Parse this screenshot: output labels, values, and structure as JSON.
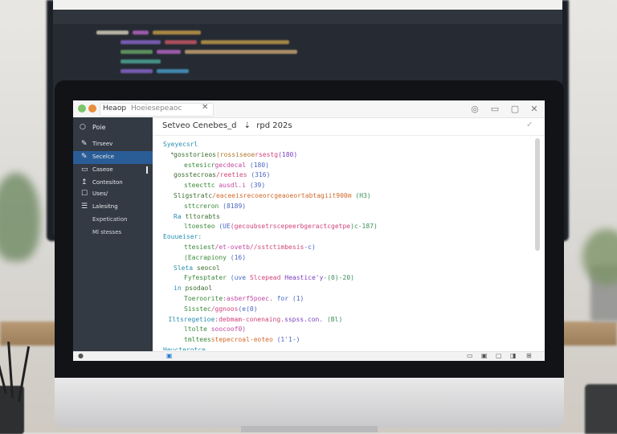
{
  "titlebar": {
    "app_name": "Heaop",
    "subtitle": "Hoeiesepeaoc",
    "close_glyph": "✕",
    "window_controls": [
      "◎",
      "▭",
      "▢",
      "✕"
    ]
  },
  "sidebar": {
    "header": "Poie",
    "items": [
      {
        "icon": "✎",
        "label": "Tirseev",
        "active": false,
        "sub": false
      },
      {
        "icon": "✎",
        "label": "Secelce",
        "active": true,
        "sub": false
      },
      {
        "icon": "▭",
        "label": "Caseoe",
        "active": false,
        "sub": false
      },
      {
        "icon": "↥",
        "label": "Contesiton",
        "active": false,
        "sub": false
      },
      {
        "icon": "☐",
        "label": "Uses/",
        "active": false,
        "sub": false
      },
      {
        "icon": "☰",
        "label": "Lalesitng",
        "active": false,
        "sub": false
      },
      {
        "icon": "",
        "label": "Expetication",
        "active": false,
        "sub": true
      },
      {
        "icon": "",
        "label": "Ml stesses",
        "active": false,
        "sub": true
      }
    ]
  },
  "editor": {
    "title": "Setveo Cenebes_d",
    "title_icon": "⇣",
    "title_suffix": "rpd 202s",
    "check": "✓",
    "lines": [
      {
        "indent": 0,
        "gutter": "",
        "segments": [
          {
            "t": "Syeyecsrl",
            "c": "#2a8fb0"
          }
        ]
      },
      {
        "indent": 2,
        "gutter": "•",
        "segments": [
          {
            "t": "gosstorieos",
            "c": "#3b6e2f"
          },
          {
            "t": "(rossiseoe",
            "c": "#b0742a"
          },
          {
            "t": "rsestg",
            "c": "#d0457b"
          },
          {
            "t": "(180)",
            "c": "#7a3fbf"
          }
        ]
      },
      {
        "indent": 4,
        "gutter": "",
        "segments": [
          {
            "t": "estesicr",
            "c": "#3b8a3b"
          },
          {
            "t": "gecdecal",
            "c": "#c24aa2"
          },
          {
            "t": " (180)",
            "c": "#4a67c4"
          }
        ]
      },
      {
        "indent": 2,
        "gutter": "",
        "segments": [
          {
            "t": "gosstecroas",
            "c": "#3b6e2f"
          },
          {
            "t": "/reeties",
            "c": "#d0457b"
          },
          {
            "t": " (316)",
            "c": "#4a67c4"
          }
        ]
      },
      {
        "indent": 4,
        "gutter": "",
        "segments": [
          {
            "t": "steecttc",
            "c": "#3b8a3b"
          },
          {
            "t": " ausdl.i",
            "c": "#c24aa2"
          },
          {
            "t": " (39)",
            "c": "#4a67c4"
          }
        ]
      },
      {
        "indent": 2,
        "gutter": "",
        "segments": [
          {
            "t": "Sligstratc",
            "c": "#3b6e2f"
          },
          {
            "t": "/eaceeisrecoeorcgeaoeortabtagiit900m",
            "c": "#d06a2a"
          },
          {
            "t": " (H3)",
            "c": "#3a8f5a"
          }
        ]
      },
      {
        "indent": 4,
        "gutter": "",
        "segments": [
          {
            "t": "sttcreron",
            "c": "#3b8a3b"
          },
          {
            "t": " (8189)",
            "c": "#4a67c4"
          }
        ]
      },
      {
        "indent": 2,
        "gutter": "",
        "segments": [
          {
            "t": "Ra",
            "c": "#2a8fb0"
          },
          {
            "t": " tltorabts",
            "c": "#3b6e2f"
          }
        ]
      },
      {
        "indent": 4,
        "gutter": "",
        "segments": [
          {
            "t": "ltoesteo",
            "c": "#3b8a3b"
          },
          {
            "t": " (UE",
            "c": "#4a67c4"
          },
          {
            "t": "(gecoubsetrscepeerbgeractcgetpe",
            "c": "#d0457b"
          },
          {
            "t": ")c-187)",
            "c": "#3a8f5a"
          }
        ]
      },
      {
        "indent": 0,
        "gutter": "",
        "segments": [
          {
            "t": "Eouueiser:",
            "c": "#2a8fb0"
          }
        ]
      },
      {
        "indent": 4,
        "gutter": "",
        "segments": [
          {
            "t": "ttesiest",
            "c": "#3b8a3b"
          },
          {
            "t": "/et-ovetb",
            "c": "#c24aa2"
          },
          {
            "t": "//sstctimbesis",
            "c": "#d0457b"
          },
          {
            "t": "-c)",
            "c": "#4a67c4"
          }
        ]
      },
      {
        "indent": 4,
        "gutter": "",
        "segments": [
          {
            "t": "(Eacrapiony",
            "c": "#3b8a3b"
          },
          {
            "t": " (16)",
            "c": "#4a67c4"
          }
        ]
      },
      {
        "indent": 2,
        "gutter": "",
        "segments": [
          {
            "t": "Sleta",
            "c": "#2a8fb0"
          },
          {
            "t": " seocol",
            "c": "#3b6e2f"
          }
        ]
      },
      {
        "indent": 4,
        "gutter": "",
        "segments": [
          {
            "t": "Fyfesptater",
            "c": "#3b8a3b"
          },
          {
            "t": " (uve",
            "c": "#4a67c4"
          },
          {
            "t": " Slcepead",
            "c": "#d0457b"
          },
          {
            "t": " Heastice'y",
            "c": "#7a3fbf"
          },
          {
            "t": "-(0)-20)",
            "c": "#3a8f5a"
          }
        ]
      },
      {
        "indent": 2,
        "gutter": "",
        "segments": [
          {
            "t": "in",
            "c": "#2a8fb0"
          },
          {
            "t": " psodaol",
            "c": "#3b6e2f"
          }
        ]
      },
      {
        "indent": 4,
        "gutter": "",
        "segments": [
          {
            "t": "Toeroorite",
            "c": "#3b8a3b"
          },
          {
            "t": ":asberf5poec.",
            "c": "#c24aa2"
          },
          {
            "t": " for (1)",
            "c": "#4a67c4"
          }
        ]
      },
      {
        "indent": 4,
        "gutter": "",
        "segments": [
          {
            "t": "Sisstec",
            "c": "#3b8a3b"
          },
          {
            "t": "/ggnoos",
            "c": "#d0457b"
          },
          {
            "t": "(e(0)",
            "c": "#4a67c4"
          }
        ]
      },
      {
        "indent": 1,
        "gutter": "",
        "segments": [
          {
            "t": "Iltsregetioe",
            "c": "#2a8fb0"
          },
          {
            "t": ":debmam-conenaing.",
            "c": "#d0457b"
          },
          {
            "t": "sspss.con.",
            "c": "#7a3fbf"
          },
          {
            "t": " (Bl)",
            "c": "#3a8f5a"
          }
        ]
      },
      {
        "indent": 4,
        "gutter": "",
        "segments": [
          {
            "t": "ltolte",
            "c": "#3b8a3b"
          },
          {
            "t": " soocoof0)",
            "c": "#c24aa2"
          }
        ]
      },
      {
        "indent": 4,
        "gutter": "",
        "segments": [
          {
            "t": "tmltees",
            "c": "#3b8a3b"
          },
          {
            "t": "stepecroal-eoteo",
            "c": "#d06a2a"
          },
          {
            "t": " (1'1-)",
            "c": "#4a67c4"
          }
        ]
      },
      {
        "indent": 0,
        "gutter": "",
        "segments": [
          {
            "t": "Heucterotce",
            "c": "#2a8fb0"
          }
        ]
      }
    ]
  },
  "statusbar": {
    "left_icon": "●",
    "mid_icon": "▣",
    "right_icons": [
      "▭",
      "▣",
      "▢",
      "◨",
      "⊞"
    ]
  },
  "background": {
    "monitor_lines": [
      {
        "text": "",
        "colors": [
          "#e8e0ce",
          "#c26ad2",
          "#b28b3a"
        ]
      }
    ]
  }
}
